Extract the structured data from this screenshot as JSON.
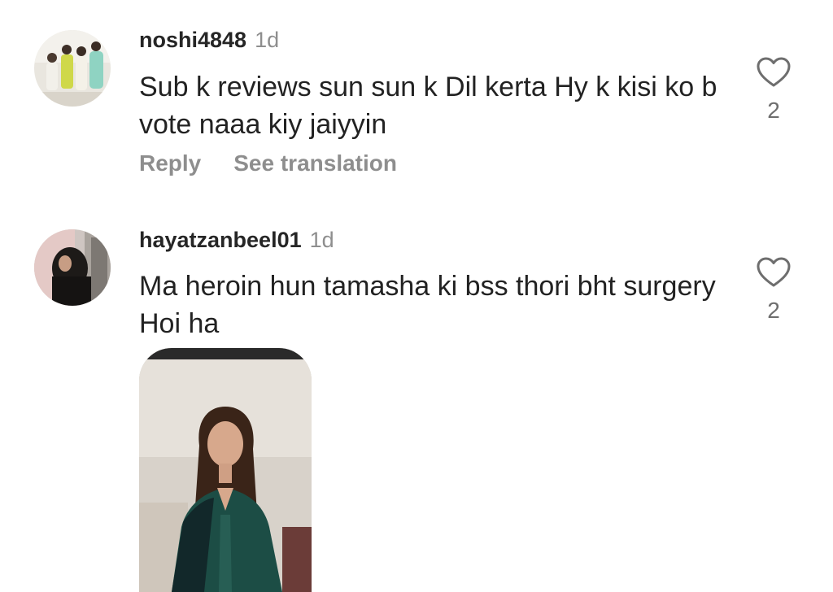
{
  "comments": [
    {
      "username": "noshi4848",
      "timestamp": "1d",
      "text": "Sub k reviews sun sun k Dil kerta Hy k kisi ko b vote naaa kiy jaiyyin",
      "like_count": "2",
      "reply_label": "Reply",
      "translate_label": "See translation"
    },
    {
      "username": "hayatzanbeel01",
      "timestamp": "1d",
      "text": "Ma heroin hun tamasha ki bss thori bht surgery Hoi ha",
      "like_count": "2"
    }
  ],
  "colors": {
    "meta_gray": "#8e8e8e",
    "text": "#222222",
    "username": "#262626"
  },
  "icons": {
    "like": "heart-outline-icon"
  }
}
